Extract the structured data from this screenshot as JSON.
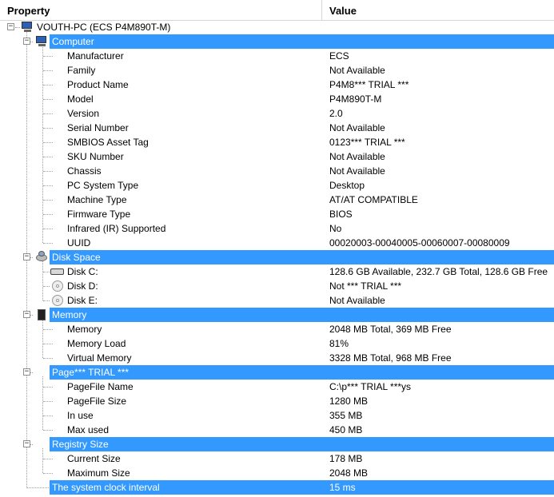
{
  "header": {
    "property_label": "Property",
    "value_label": "Value"
  },
  "root": {
    "label": "VOUTH-PC (ECS P4M890T-M)",
    "expander": "−"
  },
  "sections": {
    "computer": {
      "label": "Computer",
      "icon": "computer-icon",
      "expander": "−",
      "items": [
        {
          "property": "Manufacturer",
          "value": "ECS"
        },
        {
          "property": "Family",
          "value": "Not Available"
        },
        {
          "property": "Product Name",
          "value": "P4M8*** TRIAL ***"
        },
        {
          "property": "Model",
          "value": "P4M890T-M"
        },
        {
          "property": "Version",
          "value": "2.0"
        },
        {
          "property": "Serial Number",
          "value": "Not Available"
        },
        {
          "property": "SMBIOS Asset Tag",
          "value": "0123*** TRIAL ***"
        },
        {
          "property": "SKU Number",
          "value": "Not Available"
        },
        {
          "property": "Chassis",
          "value": "Not Available"
        },
        {
          "property": "PC System Type",
          "value": "Desktop"
        },
        {
          "property": "Machine Type",
          "value": "AT/AT COMPATIBLE"
        },
        {
          "property": "Firmware Type",
          "value": "BIOS"
        },
        {
          "property": "Infrared (IR) Supported",
          "value": "No"
        },
        {
          "property": "UUID",
          "value": "00020003-00040005-00060007-00080009"
        }
      ]
    },
    "disk": {
      "label": "Disk Space",
      "icon": "disk-space-icon",
      "expander": "−",
      "items": [
        {
          "property": "Disk C:",
          "value": "128.6 GB Available, 232.7 GB Total, 128.6 GB Free",
          "icon": "hard-drive-icon"
        },
        {
          "property": "Disk D:",
          "value": "Not *** TRIAL ***",
          "icon": "cd-drive-icon"
        },
        {
          "property": "Disk E:",
          "value": "Not Available",
          "icon": "cd-drive-icon"
        }
      ]
    },
    "memory": {
      "label": "Memory",
      "icon": "memory-chip-icon",
      "expander": "−",
      "items": [
        {
          "property": "Memory",
          "value": "2048 MB Total, 369 MB Free"
        },
        {
          "property": "Memory Load",
          "value": "81%"
        },
        {
          "property": "Virtual Memory",
          "value": "3328 MB Total, 968 MB Free"
        }
      ]
    },
    "page": {
      "label": "Page*** TRIAL ***",
      "expander": "−",
      "items": [
        {
          "property": "PageFile Name",
          "value": "C:\\p*** TRIAL ***ys"
        },
        {
          "property": "PageFile Size",
          "value": "1280 MB"
        },
        {
          "property": "In use",
          "value": "355 MB"
        },
        {
          "property": "Max used",
          "value": "450 MB"
        }
      ]
    },
    "registry": {
      "label": "Registry Size",
      "expander": "−",
      "items": [
        {
          "property": "Current Size",
          "value": "178 MB"
        },
        {
          "property": "Maximum Size",
          "value": "2048 MB"
        }
      ]
    },
    "clock": {
      "label": "The system clock interval",
      "value": "15 ms"
    }
  },
  "colors": {
    "selection": "#3399ff",
    "header_border": "#d5d5d5",
    "tree_lines": "#a0a0a0"
  }
}
